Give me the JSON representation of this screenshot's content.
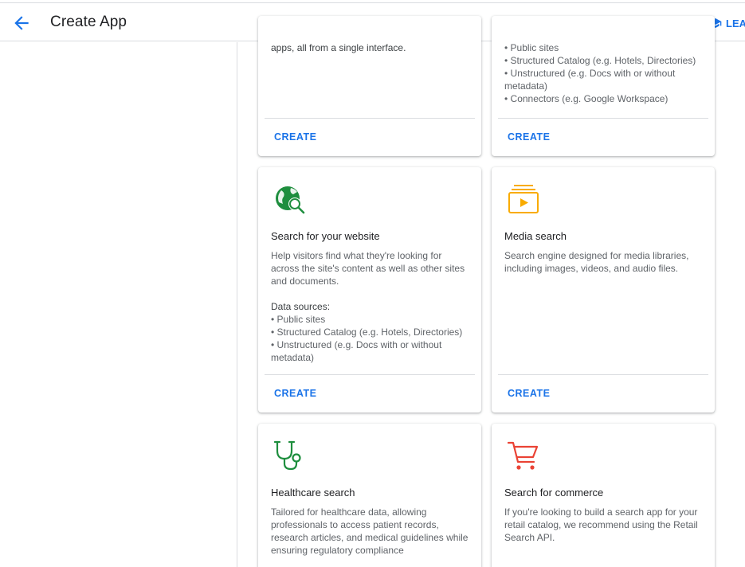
{
  "header": {
    "title": "Create App",
    "learn_label": "LEA"
  },
  "cards": {
    "top_left": {
      "description_tail": "apps, all from a single interface.",
      "create_label": "CREATE"
    },
    "top_right": {
      "sources": [
        "• Public sites",
        "• Structured Catalog (e.g. Hotels, Directories)",
        "• Unstructured (e.g. Docs with or without metadata)",
        "• Connectors (e.g. Google Workspace)"
      ],
      "create_label": "CREATE"
    },
    "website": {
      "title": "Search for your website",
      "description": "Help visitors find what they're looking for across the site's content as well as other sites and documents.",
      "sources_title": "Data sources:",
      "sources": [
        "• Public sites",
        "• Structured Catalog (e.g. Hotels, Directories)",
        "• Unstructured (e.g. Docs with or without metadata)"
      ],
      "create_label": "CREATE",
      "icon": "globe-search-icon",
      "icon_color": "#1e8e3e"
    },
    "media": {
      "title": "Media search",
      "description": "Search engine designed for media libraries, including images, videos, and audio files.",
      "create_label": "CREATE",
      "icon": "video-library-icon",
      "icon_color": "#f9ab00"
    },
    "healthcare": {
      "title": "Healthcare search",
      "description": "Tailored for healthcare data, allowing professionals to access patient records, research articles, and medical guidelines while ensuring regulatory compliance",
      "icon": "stethoscope-icon",
      "icon_color": "#1e8e3e"
    },
    "commerce": {
      "title": "Search for commerce",
      "description": "If you're looking to build a search app for your retail catalog, we recommend using the Retail Search API.",
      "icon": "shopping-cart-icon",
      "icon_color": "#ea4335"
    }
  },
  "colors": {
    "accent": "#1a73e8",
    "divider": "#dadce0"
  }
}
